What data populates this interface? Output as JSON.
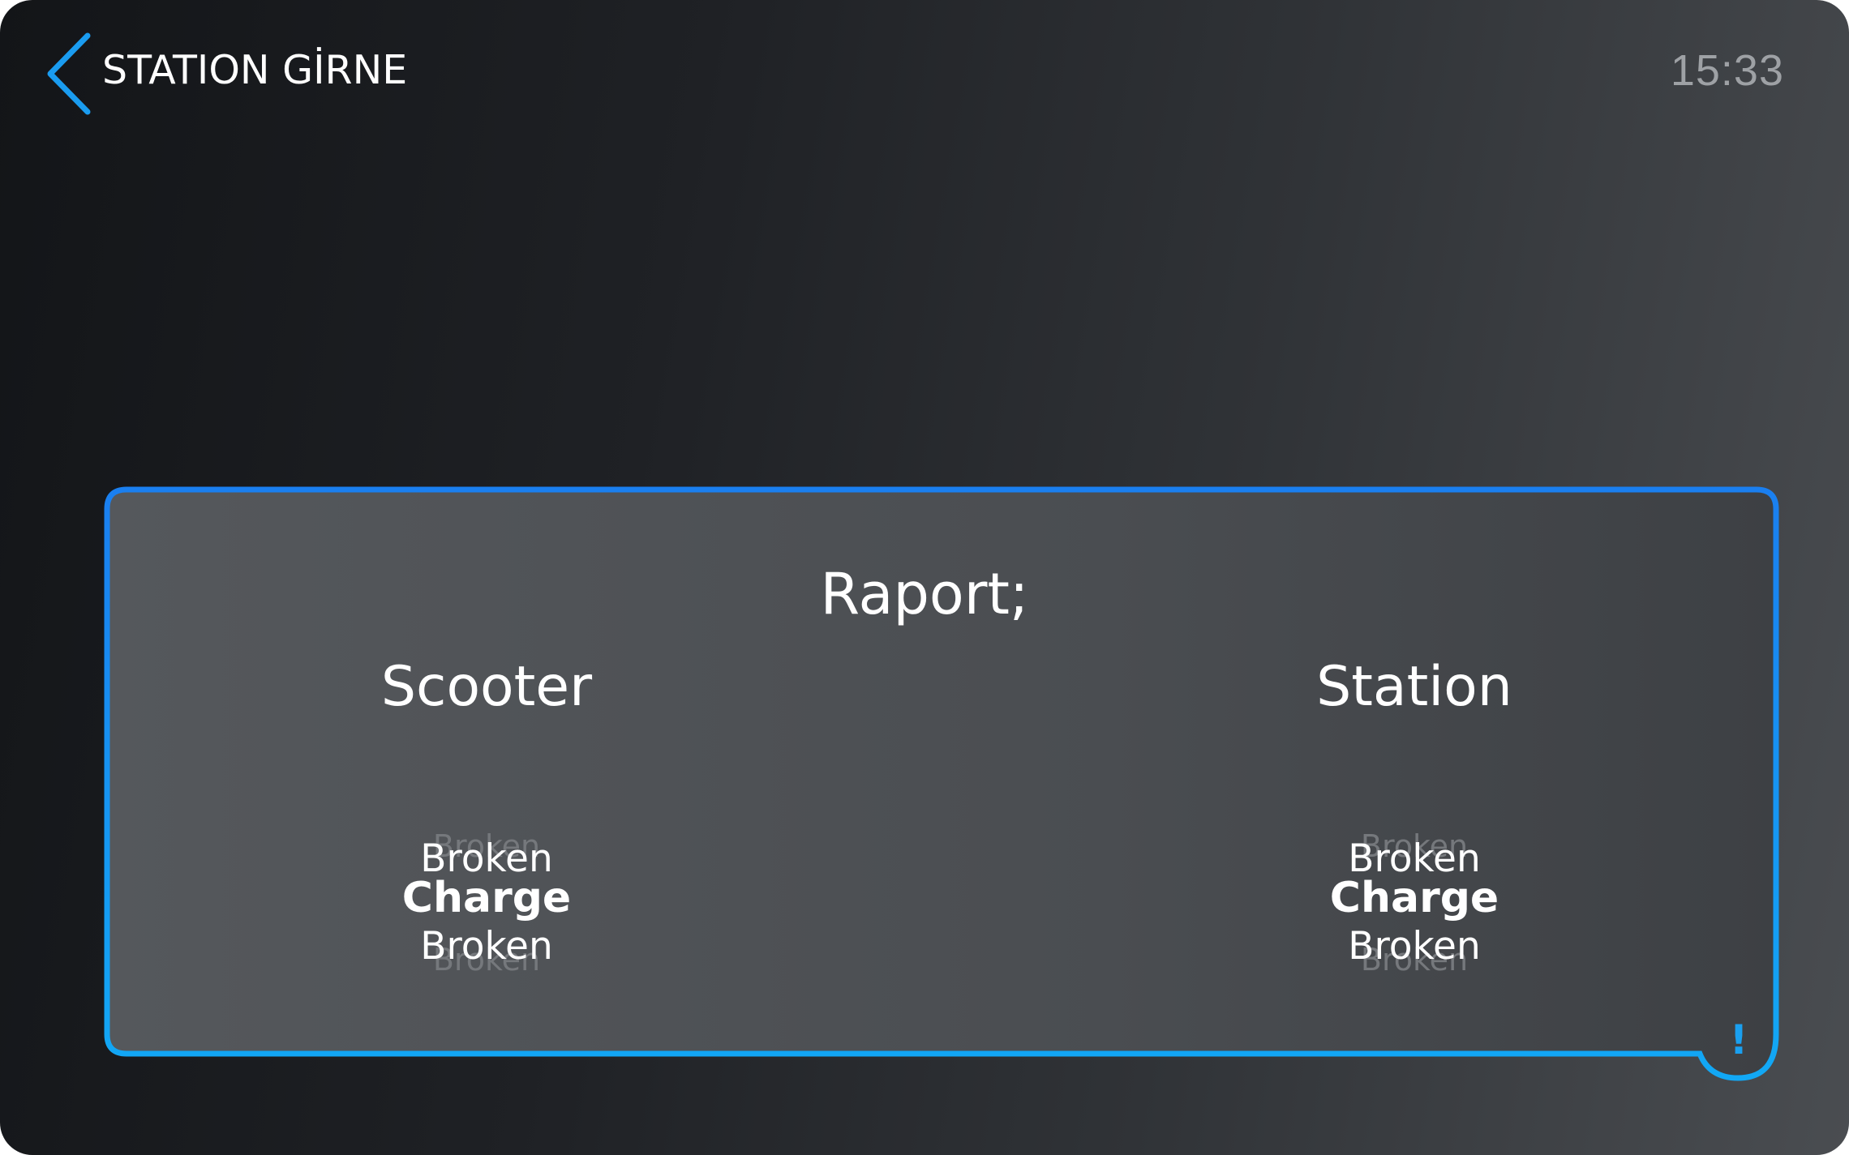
{
  "header": {
    "back_icon": "chevron-left-icon",
    "station_title": "STATION GİRNE",
    "clock": "15:33"
  },
  "panel": {
    "title": "Raport;",
    "border_color_top": "#1a7ff0",
    "border_color_bottom": "#12a8f5",
    "alert_icon": "exclamation-icon",
    "alert_label": "!",
    "columns": [
      {
        "heading": "Scooter",
        "picker": {
          "above_far": "Broken",
          "above": "Broken",
          "selected": "Charge",
          "below": "Broken",
          "below_far": "Broken"
        }
      },
      {
        "heading": "Station",
        "picker": {
          "above_far": "Broken",
          "above": "Broken",
          "selected": "Charge",
          "below": "Broken",
          "below_far": "Broken"
        }
      }
    ]
  }
}
